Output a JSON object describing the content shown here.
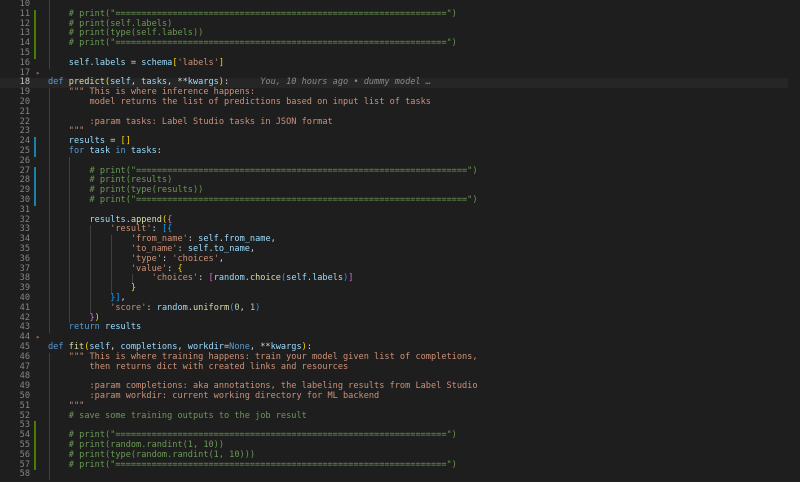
{
  "editor": {
    "blame": "You, 10 hours ago • dummy model …",
    "lines": [
      {
        "n": "10",
        "mark": "",
        "fold": "",
        "indent": 2,
        "t": []
      },
      {
        "n": "11",
        "mark": "add",
        "fold": "",
        "indent": 2,
        "t": [
          [
            "cm",
            "# print(\"================================================================\")"
          ]
        ]
      },
      {
        "n": "12",
        "mark": "add",
        "fold": "",
        "indent": 2,
        "t": [
          [
            "cm",
            "# print(self.labels)"
          ]
        ]
      },
      {
        "n": "13",
        "mark": "add",
        "fold": "",
        "indent": 2,
        "t": [
          [
            "cm",
            "# print(type(self.labels))"
          ]
        ]
      },
      {
        "n": "14",
        "mark": "add",
        "fold": "",
        "indent": 2,
        "t": [
          [
            "cm",
            "# print(\"================================================================\")"
          ]
        ]
      },
      {
        "n": "15",
        "mark": "add",
        "fold": "",
        "indent": 2,
        "t": []
      },
      {
        "n": "16",
        "mark": "",
        "fold": "",
        "indent": 2,
        "t": [
          [
            "va",
            "self"
          ],
          [
            "op",
            "."
          ],
          [
            "va",
            "labels"
          ],
          [
            "op",
            " = "
          ],
          [
            "va",
            "schema"
          ],
          [
            "pa",
            "["
          ],
          [
            "st",
            "'labels'"
          ],
          [
            "pa",
            "]"
          ]
        ]
      },
      {
        "n": "17",
        "mark": "",
        "fold": "dot",
        "indent": 1,
        "t": []
      },
      {
        "n": "18",
        "mark": "",
        "fold": "",
        "indent": 1,
        "current": true,
        "t": [
          [
            "kw",
            "def "
          ],
          [
            "fn",
            "predict"
          ],
          [
            "pa",
            "("
          ],
          [
            "va",
            "self"
          ],
          [
            "op",
            ", "
          ],
          [
            "va",
            "tasks"
          ],
          [
            "op",
            ", **"
          ],
          [
            "va",
            "kwargs"
          ],
          [
            "pa",
            ")"
          ],
          [
            "op",
            ":"
          ]
        ],
        "blame": true
      },
      {
        "n": "19",
        "mark": "",
        "fold": "",
        "indent": 2,
        "t": [
          [
            "st",
            "\"\"\" This is where inference happens:"
          ]
        ]
      },
      {
        "n": "20",
        "mark": "",
        "fold": "",
        "indent": 2,
        "t": [
          [
            "st",
            "    model returns the list of predictions based on input list of tasks"
          ]
        ]
      },
      {
        "n": "21",
        "mark": "",
        "fold": "",
        "indent": 2,
        "t": []
      },
      {
        "n": "22",
        "mark": "",
        "fold": "",
        "indent": 2,
        "t": [
          [
            "st",
            "    :param tasks: Label Studio tasks in JSON format"
          ]
        ]
      },
      {
        "n": "23",
        "mark": "",
        "fold": "",
        "indent": 2,
        "t": [
          [
            "st",
            "\"\"\""
          ]
        ]
      },
      {
        "n": "24",
        "mark": "mod",
        "fold": "",
        "indent": 2,
        "t": [
          [
            "va",
            "results"
          ],
          [
            "op",
            " = "
          ],
          [
            "pa",
            "[]"
          ]
        ]
      },
      {
        "n": "25",
        "mark": "mod",
        "fold": "",
        "indent": 2,
        "t": [
          [
            "kw",
            "for "
          ],
          [
            "va",
            "task"
          ],
          [
            "kw",
            " in "
          ],
          [
            "va",
            "tasks"
          ],
          [
            "op",
            ":"
          ]
        ]
      },
      {
        "n": "26",
        "mark": "",
        "fold": "",
        "indent": 3,
        "t": []
      },
      {
        "n": "27",
        "mark": "mod",
        "fold": "",
        "indent": 3,
        "t": [
          [
            "cm",
            "    # print(\"================================================================\")"
          ]
        ]
      },
      {
        "n": "28",
        "mark": "mod",
        "fold": "",
        "indent": 3,
        "t": [
          [
            "cm",
            "    # print(results)"
          ]
        ]
      },
      {
        "n": "29",
        "mark": "mod",
        "fold": "",
        "indent": 3,
        "t": [
          [
            "cm",
            "    # print(type(results))"
          ]
        ]
      },
      {
        "n": "30",
        "mark": "mod",
        "fold": "",
        "indent": 3,
        "t": [
          [
            "cm",
            "    # print(\"================================================================\")"
          ]
        ]
      },
      {
        "n": "31",
        "mark": "",
        "fold": "",
        "indent": 3,
        "t": []
      },
      {
        "n": "32",
        "mark": "",
        "fold": "",
        "indent": 3,
        "t": [
          [
            "va",
            "    results"
          ],
          [
            "op",
            "."
          ],
          [
            "fn",
            "append"
          ],
          [
            "pa",
            "("
          ],
          [
            "pb",
            "{"
          ]
        ]
      },
      {
        "n": "33",
        "mark": "",
        "fold": "",
        "indent": 4,
        "t": [
          [
            "st",
            "        'result'"
          ],
          [
            "op",
            ": "
          ],
          [
            "pc",
            "[{"
          ]
        ]
      },
      {
        "n": "34",
        "mark": "",
        "fold": "",
        "indent": 5,
        "t": [
          [
            "st",
            "            'from_name'"
          ],
          [
            "op",
            ": "
          ],
          [
            "va",
            "self"
          ],
          [
            "op",
            "."
          ],
          [
            "va",
            "from_name"
          ],
          [
            "op",
            ","
          ]
        ]
      },
      {
        "n": "35",
        "mark": "",
        "fold": "",
        "indent": 5,
        "t": [
          [
            "st",
            "            'to_name'"
          ],
          [
            "op",
            ": "
          ],
          [
            "va",
            "self"
          ],
          [
            "op",
            "."
          ],
          [
            "va",
            "to_name"
          ],
          [
            "op",
            ","
          ]
        ]
      },
      {
        "n": "36",
        "mark": "",
        "fold": "",
        "indent": 5,
        "t": [
          [
            "st",
            "            'type'"
          ],
          [
            "op",
            ": "
          ],
          [
            "st",
            "'choices'"
          ],
          [
            "op",
            ","
          ]
        ]
      },
      {
        "n": "37",
        "mark": "",
        "fold": "",
        "indent": 5,
        "t": [
          [
            "st",
            "            'value'"
          ],
          [
            "op",
            ": "
          ],
          [
            "pa",
            "{"
          ]
        ]
      },
      {
        "n": "38",
        "mark": "",
        "fold": "",
        "indent": 6,
        "t": [
          [
            "st",
            "                'choices'"
          ],
          [
            "op",
            ": "
          ],
          [
            "pb",
            "["
          ],
          [
            "va",
            "random"
          ],
          [
            "op",
            "."
          ],
          [
            "fn",
            "choice"
          ],
          [
            "pc",
            "("
          ],
          [
            "va",
            "self"
          ],
          [
            "op",
            "."
          ],
          [
            "va",
            "labels"
          ],
          [
            "pc",
            ")"
          ],
          [
            "pb",
            "]"
          ]
        ]
      },
      {
        "n": "39",
        "mark": "",
        "fold": "",
        "indent": 5,
        "t": [
          [
            "pa",
            "            }"
          ]
        ]
      },
      {
        "n": "40",
        "mark": "",
        "fold": "",
        "indent": 4,
        "t": [
          [
            "pc",
            "        }]"
          ],
          [
            "op",
            ","
          ]
        ]
      },
      {
        "n": "41",
        "mark": "",
        "fold": "",
        "indent": 4,
        "t": [
          [
            "st",
            "        'score'"
          ],
          [
            "op",
            ": "
          ],
          [
            "va",
            "random"
          ],
          [
            "op",
            "."
          ],
          [
            "fn",
            "uniform"
          ],
          [
            "pc",
            "("
          ],
          [
            "nu",
            "0"
          ],
          [
            "op",
            ", "
          ],
          [
            "nu",
            "1"
          ],
          [
            "pc",
            ")"
          ]
        ]
      },
      {
        "n": "42",
        "mark": "",
        "fold": "",
        "indent": 3,
        "t": [
          [
            "pb",
            "    }"
          ],
          [
            "pa",
            ")"
          ]
        ]
      },
      {
        "n": "43",
        "mark": "",
        "fold": "",
        "indent": 2,
        "t": [
          [
            "kw",
            "return "
          ],
          [
            "va",
            "results"
          ]
        ]
      },
      {
        "n": "44",
        "mark": "",
        "fold": "dot",
        "indent": 1,
        "t": []
      },
      {
        "n": "45",
        "mark": "",
        "fold": "",
        "indent": 1,
        "t": [
          [
            "kw",
            "def "
          ],
          [
            "fn",
            "fit"
          ],
          [
            "pa",
            "("
          ],
          [
            "va",
            "self"
          ],
          [
            "op",
            ", "
          ],
          [
            "va",
            "completions"
          ],
          [
            "op",
            ", "
          ],
          [
            "va",
            "workdir"
          ],
          [
            "op",
            "="
          ],
          [
            "kw",
            "None"
          ],
          [
            "op",
            ", **"
          ],
          [
            "va",
            "kwargs"
          ],
          [
            "pa",
            ")"
          ],
          [
            "op",
            ":"
          ]
        ]
      },
      {
        "n": "46",
        "mark": "",
        "fold": "",
        "indent": 2,
        "t": [
          [
            "st",
            "\"\"\" This is where training happens: train your model given list of completions,"
          ]
        ]
      },
      {
        "n": "47",
        "mark": "",
        "fold": "",
        "indent": 2,
        "t": [
          [
            "st",
            "    then returns dict with created links and resources"
          ]
        ]
      },
      {
        "n": "48",
        "mark": "",
        "fold": "",
        "indent": 2,
        "t": []
      },
      {
        "n": "49",
        "mark": "",
        "fold": "",
        "indent": 2,
        "t": [
          [
            "st",
            "    :param completions: aka annotations, the labeling results from Label Studio"
          ]
        ]
      },
      {
        "n": "50",
        "mark": "",
        "fold": "",
        "indent": 2,
        "t": [
          [
            "st",
            "    :param workdir: current working directory for ML backend"
          ]
        ]
      },
      {
        "n": "51",
        "mark": "",
        "fold": "",
        "indent": 2,
        "t": [
          [
            "st",
            "\"\"\""
          ]
        ]
      },
      {
        "n": "52",
        "mark": "",
        "fold": "",
        "indent": 2,
        "t": [
          [
            "cm",
            "# save some training outputs to the job result"
          ]
        ]
      },
      {
        "n": "53",
        "mark": "add",
        "fold": "",
        "indent": 2,
        "t": []
      },
      {
        "n": "54",
        "mark": "add",
        "fold": "",
        "indent": 2,
        "t": [
          [
            "cm",
            "# print(\"================================================================\")"
          ]
        ]
      },
      {
        "n": "55",
        "mark": "add",
        "fold": "",
        "indent": 2,
        "t": [
          [
            "cm",
            "# print(random.randint(1, 10))"
          ]
        ]
      },
      {
        "n": "56",
        "mark": "add",
        "fold": "",
        "indent": 2,
        "t": [
          [
            "cm",
            "# print(type(random.randint(1, 10)))"
          ]
        ]
      },
      {
        "n": "57",
        "mark": "add",
        "fold": "",
        "indent": 2,
        "t": [
          [
            "cm",
            "# print(\"================================================================\")"
          ]
        ]
      },
      {
        "n": "58",
        "mark": "",
        "fold": "",
        "indent": 2,
        "t": []
      }
    ]
  }
}
